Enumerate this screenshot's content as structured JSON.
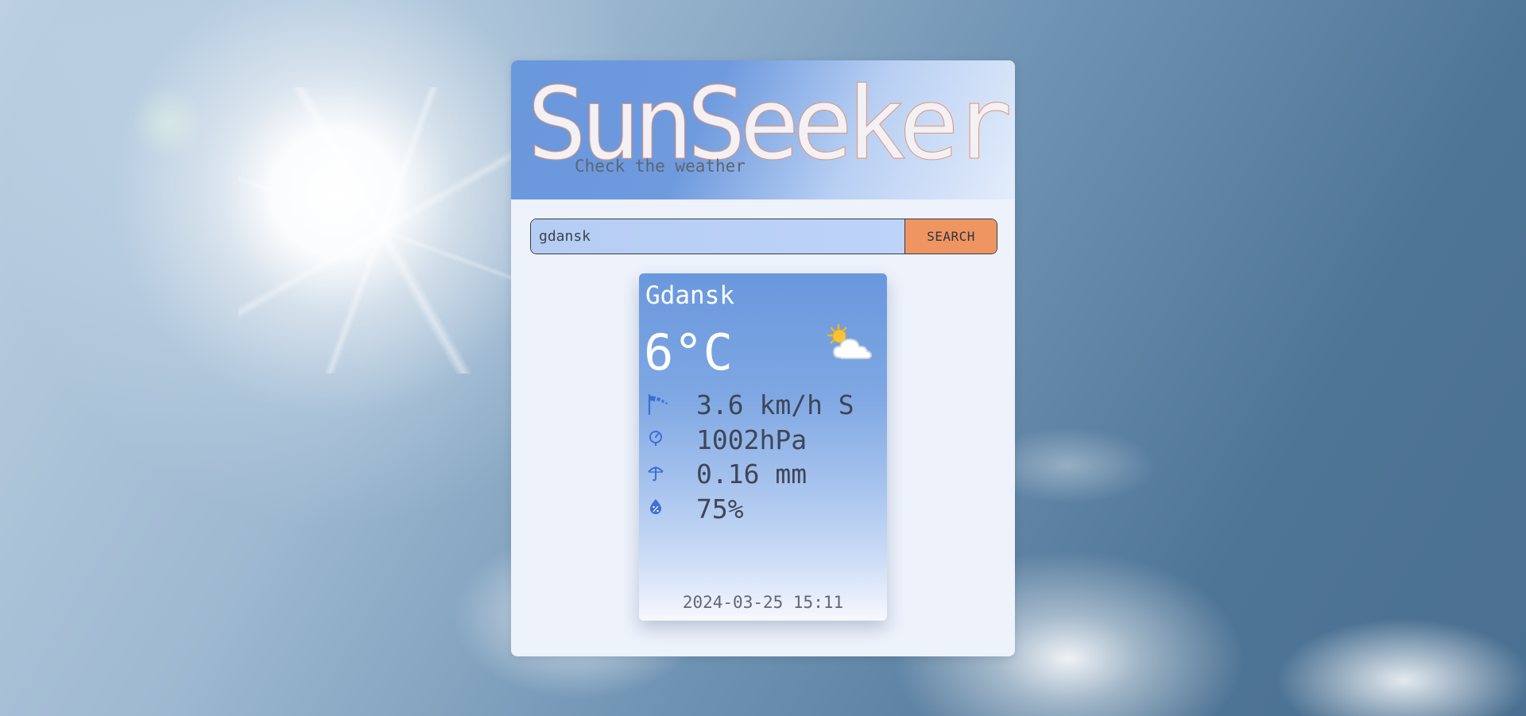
{
  "app": {
    "title": "SunSeeker",
    "subtitle": "Check the weather"
  },
  "search": {
    "value": "gdansk",
    "button_label": "SEARCH"
  },
  "weather": {
    "city": "Gdansk",
    "temperature": "6°C",
    "condition_icon": "sun-behind-cloud-icon",
    "wind": "3.6 km/h S",
    "pressure": "1002hPa",
    "precipitation": "0.16 mm",
    "humidity": "75%",
    "timestamp": "2024-03-25 15:11"
  },
  "colors": {
    "accent_orange": "#ef9562",
    "header_blue": "#6a98dd",
    "panel_bg": "#edf2fb",
    "icon_blue": "#3d6fd4"
  },
  "icons": {
    "wind": "windsock-icon",
    "pressure": "pressure-gauge-icon",
    "precipitation": "umbrella-icon",
    "humidity": "humidity-drop-icon"
  }
}
